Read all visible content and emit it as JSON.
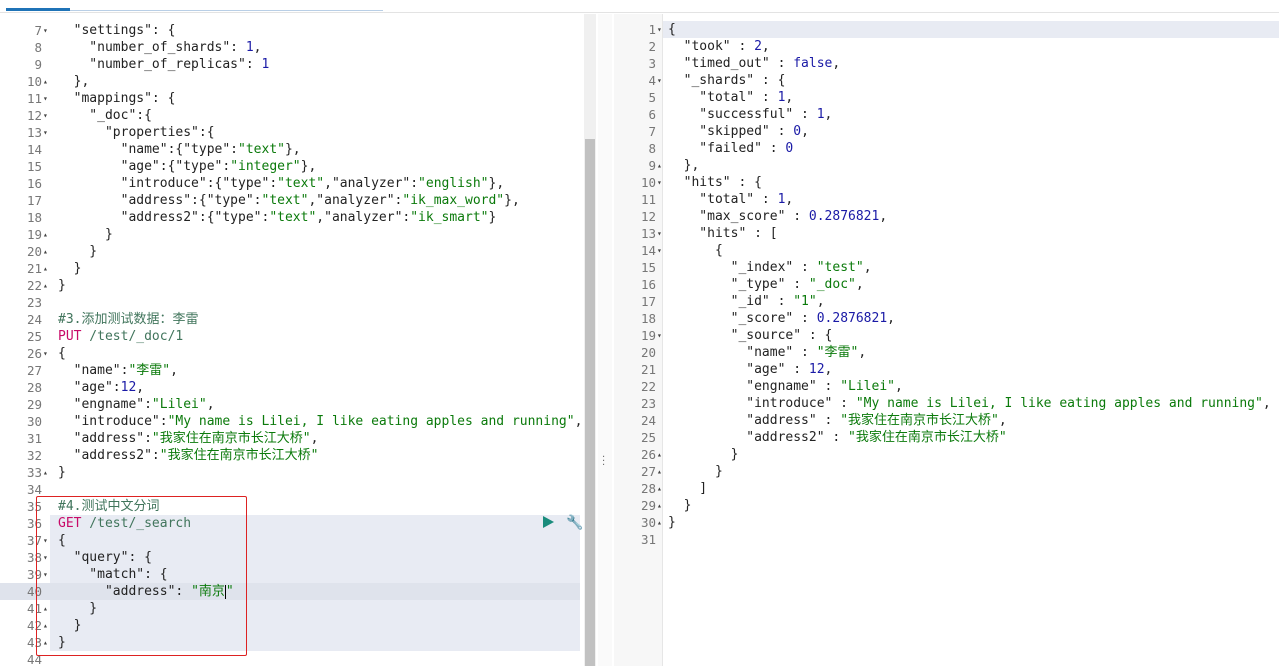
{
  "left_editor": {
    "lines": [
      {
        "n": "7",
        "f": "▾",
        "t": [
          [
            "p",
            "  \""
          ],
          [
            "p",
            "settings"
          ],
          [
            "p",
            "\": {"
          ]
        ]
      },
      {
        "n": "8",
        "f": "",
        "t": [
          [
            "p",
            "    \"number_of_shards\": "
          ],
          [
            "k",
            "1"
          ],
          [
            "p",
            ","
          ]
        ]
      },
      {
        "n": "9",
        "f": "",
        "t": [
          [
            "p",
            "    \"number_of_replicas\": "
          ],
          [
            "k",
            "1"
          ]
        ]
      },
      {
        "n": "10",
        "f": "▴",
        "t": [
          [
            "p",
            "  },"
          ]
        ]
      },
      {
        "n": "11",
        "f": "▾",
        "t": [
          [
            "p",
            "  \"mappings\": {"
          ]
        ]
      },
      {
        "n": "12",
        "f": "▾",
        "t": [
          [
            "p",
            "    \"_doc\":{"
          ]
        ]
      },
      {
        "n": "13",
        "f": "▾",
        "t": [
          [
            "p",
            "      \"properties\":{"
          ]
        ]
      },
      {
        "n": "14",
        "f": "",
        "t": [
          [
            "p",
            "        \"name\":{\"type\":"
          ],
          [
            "s",
            "\"text\""
          ],
          [
            "p",
            "},"
          ]
        ]
      },
      {
        "n": "15",
        "f": "",
        "t": [
          [
            "p",
            "        \"age\":{\"type\":"
          ],
          [
            "s",
            "\"integer\""
          ],
          [
            "p",
            "},"
          ]
        ]
      },
      {
        "n": "16",
        "f": "",
        "t": [
          [
            "p",
            "        \"introduce\":{\"type\":"
          ],
          [
            "s",
            "\"text\""
          ],
          [
            "p",
            ",\"analyzer\":"
          ],
          [
            "s",
            "\"english\""
          ],
          [
            "p",
            "},"
          ]
        ]
      },
      {
        "n": "17",
        "f": "",
        "t": [
          [
            "p",
            "        \"address\":{\"type\":"
          ],
          [
            "s",
            "\"text\""
          ],
          [
            "p",
            ",\"analyzer\":"
          ],
          [
            "s",
            "\"ik_max_word\""
          ],
          [
            "p",
            "},"
          ]
        ]
      },
      {
        "n": "18",
        "f": "",
        "t": [
          [
            "p",
            "        \"address2\":{\"type\":"
          ],
          [
            "s",
            "\"text\""
          ],
          [
            "p",
            ",\"analyzer\":"
          ],
          [
            "s",
            "\"ik_smart\""
          ],
          [
            "p",
            "}"
          ]
        ]
      },
      {
        "n": "19",
        "f": "▴",
        "t": [
          [
            "p",
            "      }"
          ]
        ]
      },
      {
        "n": "20",
        "f": "▴",
        "t": [
          [
            "p",
            "    }"
          ]
        ]
      },
      {
        "n": "21",
        "f": "▴",
        "t": [
          [
            "p",
            "  }"
          ]
        ]
      },
      {
        "n": "22",
        "f": "▴",
        "t": [
          [
            "p",
            "}"
          ]
        ]
      },
      {
        "n": "23",
        "f": "",
        "t": []
      },
      {
        "n": "24",
        "f": "",
        "t": [
          [
            "c",
            "#3.添加测试数据：李雷"
          ]
        ]
      },
      {
        "n": "25",
        "f": "",
        "t": [
          [
            "m",
            "PUT"
          ],
          [
            "c",
            " /test/_doc/1"
          ]
        ]
      },
      {
        "n": "26",
        "f": "▾",
        "t": [
          [
            "p",
            "{"
          ]
        ]
      },
      {
        "n": "27",
        "f": "",
        "t": [
          [
            "p",
            "  \"name\":"
          ],
          [
            "s",
            "\"李雷\""
          ],
          [
            "p",
            ","
          ]
        ]
      },
      {
        "n": "28",
        "f": "",
        "t": [
          [
            "p",
            "  \"age\":"
          ],
          [
            "k",
            "12"
          ],
          [
            "p",
            ","
          ]
        ]
      },
      {
        "n": "29",
        "f": "",
        "t": [
          [
            "p",
            "  \"engname\":"
          ],
          [
            "s",
            "\"Lilei\""
          ],
          [
            "p",
            ","
          ]
        ]
      },
      {
        "n": "30",
        "f": "",
        "t": [
          [
            "p",
            "  \"introduce\":"
          ],
          [
            "s",
            "\"My name is Lilei, I like eating apples and running\""
          ],
          [
            "p",
            ","
          ]
        ]
      },
      {
        "n": "31",
        "f": "",
        "t": [
          [
            "p",
            "  \"address\":"
          ],
          [
            "s",
            "\"我家住在南京市长江大桥\""
          ],
          [
            "p",
            ","
          ]
        ]
      },
      {
        "n": "32",
        "f": "",
        "t": [
          [
            "p",
            "  \"address2\":"
          ],
          [
            "s",
            "\"我家住在南京市长江大桥\""
          ]
        ]
      },
      {
        "n": "33",
        "f": "▴",
        "t": [
          [
            "p",
            "}"
          ]
        ]
      },
      {
        "n": "34",
        "f": "",
        "t": []
      },
      {
        "n": "35",
        "f": "",
        "t": [
          [
            "c",
            "#4.测试中文分词"
          ]
        ]
      },
      {
        "n": "36",
        "f": "",
        "t": [
          [
            "m",
            "GET"
          ],
          [
            "c",
            " /test/_search"
          ]
        ]
      },
      {
        "n": "37",
        "f": "▾",
        "t": [
          [
            "p",
            "{"
          ]
        ]
      },
      {
        "n": "38",
        "f": "▾",
        "t": [
          [
            "p",
            "  \"query\": {"
          ]
        ]
      },
      {
        "n": "39",
        "f": "▾",
        "t": [
          [
            "p",
            "    \"match\": {"
          ]
        ]
      },
      {
        "n": "40",
        "f": "",
        "t": [
          [
            "p",
            "      \"address\": "
          ],
          [
            "s",
            "\"南京"
          ],
          [
            "cursor",
            ""
          ],
          [
            "s",
            "\""
          ]
        ]
      },
      {
        "n": "41",
        "f": "▴",
        "t": [
          [
            "p",
            "    }"
          ]
        ]
      },
      {
        "n": "42",
        "f": "▴",
        "t": [
          [
            "p",
            "  }"
          ]
        ]
      },
      {
        "n": "43",
        "f": "▴",
        "t": [
          [
            "p",
            "}"
          ]
        ]
      },
      {
        "n": "44",
        "f": "",
        "t": []
      }
    ]
  },
  "right_editor": {
    "lines": [
      {
        "n": "1",
        "f": "▾",
        "t": [
          [
            "p",
            "{"
          ]
        ]
      },
      {
        "n": "2",
        "f": "",
        "t": [
          [
            "p",
            "  \"took\" : "
          ],
          [
            "k",
            "2"
          ],
          [
            "p",
            ","
          ]
        ]
      },
      {
        "n": "3",
        "f": "",
        "t": [
          [
            "p",
            "  \"timed_out\" : "
          ],
          [
            "k",
            "false"
          ],
          [
            "p",
            ","
          ]
        ]
      },
      {
        "n": "4",
        "f": "▾",
        "t": [
          [
            "p",
            "  \"_shards\" : {"
          ]
        ]
      },
      {
        "n": "5",
        "f": "",
        "t": [
          [
            "p",
            "    \"total\" : "
          ],
          [
            "k",
            "1"
          ],
          [
            "p",
            ","
          ]
        ]
      },
      {
        "n": "6",
        "f": "",
        "t": [
          [
            "p",
            "    \"successful\" : "
          ],
          [
            "k",
            "1"
          ],
          [
            "p",
            ","
          ]
        ]
      },
      {
        "n": "7",
        "f": "",
        "t": [
          [
            "p",
            "    \"skipped\" : "
          ],
          [
            "k",
            "0"
          ],
          [
            "p",
            ","
          ]
        ]
      },
      {
        "n": "8",
        "f": "",
        "t": [
          [
            "p",
            "    \"failed\" : "
          ],
          [
            "k",
            "0"
          ]
        ]
      },
      {
        "n": "9",
        "f": "▴",
        "t": [
          [
            "p",
            "  },"
          ]
        ]
      },
      {
        "n": "10",
        "f": "▾",
        "t": [
          [
            "p",
            "  \"hits\" : {"
          ]
        ]
      },
      {
        "n": "11",
        "f": "",
        "t": [
          [
            "p",
            "    \"total\" : "
          ],
          [
            "k",
            "1"
          ],
          [
            "p",
            ","
          ]
        ]
      },
      {
        "n": "12",
        "f": "",
        "t": [
          [
            "p",
            "    \"max_score\" : "
          ],
          [
            "k",
            "0.2876821"
          ],
          [
            "p",
            ","
          ]
        ]
      },
      {
        "n": "13",
        "f": "▾",
        "t": [
          [
            "p",
            "    \"hits\" : ["
          ]
        ]
      },
      {
        "n": "14",
        "f": "▾",
        "t": [
          [
            "p",
            "      {"
          ]
        ]
      },
      {
        "n": "15",
        "f": "",
        "t": [
          [
            "p",
            "        \"_index\" : "
          ],
          [
            "s",
            "\"test\""
          ],
          [
            "p",
            ","
          ]
        ]
      },
      {
        "n": "16",
        "f": "",
        "t": [
          [
            "p",
            "        \"_type\" : "
          ],
          [
            "s",
            "\"_doc\""
          ],
          [
            "p",
            ","
          ]
        ]
      },
      {
        "n": "17",
        "f": "",
        "t": [
          [
            "p",
            "        \"_id\" : "
          ],
          [
            "s",
            "\"1\""
          ],
          [
            "p",
            ","
          ]
        ]
      },
      {
        "n": "18",
        "f": "",
        "t": [
          [
            "p",
            "        \"_score\" : "
          ],
          [
            "k",
            "0.2876821"
          ],
          [
            "p",
            ","
          ]
        ]
      },
      {
        "n": "19",
        "f": "▾",
        "t": [
          [
            "p",
            "        \"_source\" : {"
          ]
        ]
      },
      {
        "n": "20",
        "f": "",
        "t": [
          [
            "p",
            "          \"name\" : "
          ],
          [
            "s",
            "\"李雷\""
          ],
          [
            "p",
            ","
          ]
        ]
      },
      {
        "n": "21",
        "f": "",
        "t": [
          [
            "p",
            "          \"age\" : "
          ],
          [
            "k",
            "12"
          ],
          [
            "p",
            ","
          ]
        ]
      },
      {
        "n": "22",
        "f": "",
        "t": [
          [
            "p",
            "          \"engname\" : "
          ],
          [
            "s",
            "\"Lilei\""
          ],
          [
            "p",
            ","
          ]
        ]
      },
      {
        "n": "23",
        "f": "",
        "t": [
          [
            "p",
            "          \"introduce\" : "
          ],
          [
            "s",
            "\"My name is Lilei, I like eating apples and running\""
          ],
          [
            "p",
            ","
          ]
        ]
      },
      {
        "n": "24",
        "f": "",
        "t": [
          [
            "p",
            "          \"address\" : "
          ],
          [
            "s",
            "\"我家住在南京市长江大桥\""
          ],
          [
            "p",
            ","
          ]
        ]
      },
      {
        "n": "25",
        "f": "",
        "t": [
          [
            "p",
            "          \"address2\" : "
          ],
          [
            "s",
            "\"我家住在南京市长江大桥\""
          ]
        ]
      },
      {
        "n": "26",
        "f": "▴",
        "t": [
          [
            "p",
            "        }"
          ]
        ]
      },
      {
        "n": "27",
        "f": "▴",
        "t": [
          [
            "p",
            "      }"
          ]
        ]
      },
      {
        "n": "28",
        "f": "▴",
        "t": [
          [
            "p",
            "    ]"
          ]
        ]
      },
      {
        "n": "29",
        "f": "▴",
        "t": [
          [
            "p",
            "  }"
          ]
        ]
      },
      {
        "n": "30",
        "f": "▴",
        "t": [
          [
            "p",
            "}"
          ]
        ]
      },
      {
        "n": "31",
        "f": "",
        "t": []
      }
    ]
  },
  "icons": {
    "run": "play-icon",
    "settings": "wrench-icon",
    "resize": "drag-handle-icon"
  },
  "colors": {
    "key": "#222222",
    "string": "#0b7a0b",
    "number": "#1a1aa6",
    "method": "#c80a68",
    "comment": "#41755c",
    "selection": "#e8ebf3",
    "highlight_box": "#dd2222",
    "run_button": "#1a8c7c"
  }
}
